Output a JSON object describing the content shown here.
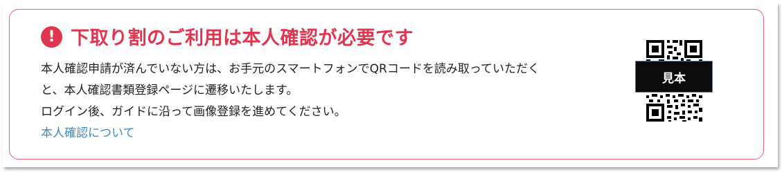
{
  "notice": {
    "icon": "exclamation-circle-icon",
    "accent_color": "#e0344f",
    "border_color": "#e2627a",
    "link_color": "#3a8bc4",
    "heading": "下取り割のご利用は本人確認が必要です",
    "body_lines": [
      "本人確認申請が済んでいない方は、お手元のスマートフォンでQRコードを読み取っていただく",
      "と、本人確認書類登録ページに遷移いたします。",
      "ログイン後、ガイドに沿って画像登録を進めてください。"
    ],
    "link_text": "本人確認について"
  },
  "qr": {
    "icon": "qr-code-icon",
    "sample_label": "見本"
  }
}
